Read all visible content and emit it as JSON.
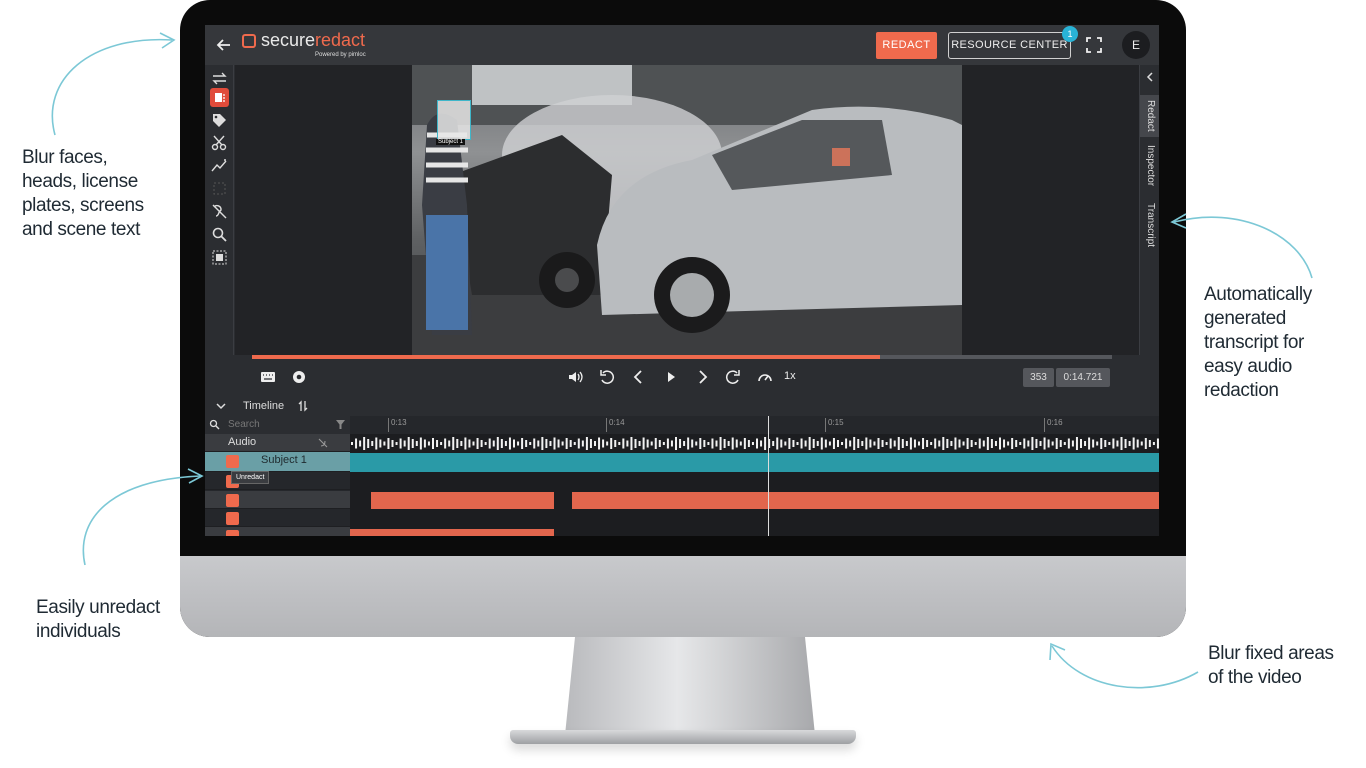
{
  "callouts": {
    "blur_faces": [
      "Blur faces,",
      "heads, license",
      "plates, screens",
      "and scene text"
    ],
    "transcript": [
      "Automatically",
      "generated",
      "transcript for",
      "easy audio",
      "redaction"
    ],
    "unredact": [
      "Easily unredact",
      "individuals"
    ],
    "fixed_areas": [
      "Blur fixed areas",
      "of the video"
    ]
  },
  "colors": {
    "accent": "#ef6a4d",
    "teal": "#2a9aa7",
    "badge": "#29b3d6",
    "arrow": "#7cc8d6"
  },
  "app": {
    "logo": {
      "word_plain": "secure",
      "word_accent": "redact",
      "powered": "Powered by pimloc"
    },
    "header": {
      "redact_label": "REDACT",
      "resource_label": "RESOURCE CENTER",
      "notification_count": "1",
      "avatar_initial": "E"
    },
    "toolbar_icons": [
      "swap-icon",
      "redact-list-icon",
      "tag-icon",
      "scissors-icon",
      "magic-icon",
      "box-select-icon",
      "audio-off-icon",
      "search-icon",
      "frame-select-icon"
    ],
    "video": {
      "subject_label": "Subject 1"
    },
    "side_tabs": [
      "Redact",
      "Inspector",
      "Transcript"
    ],
    "progress": 0.73,
    "controls": {
      "speed": "1x",
      "frame": "353",
      "time": "0:14.721"
    },
    "timeline": {
      "title": "Timeline",
      "search_placeholder": "Search",
      "audio_label": "Audio",
      "subject_label": "Subject 1",
      "tooltip": "Unredact",
      "ticks": [
        "0:13",
        "0:14",
        "0:15",
        "0:16"
      ]
    }
  }
}
